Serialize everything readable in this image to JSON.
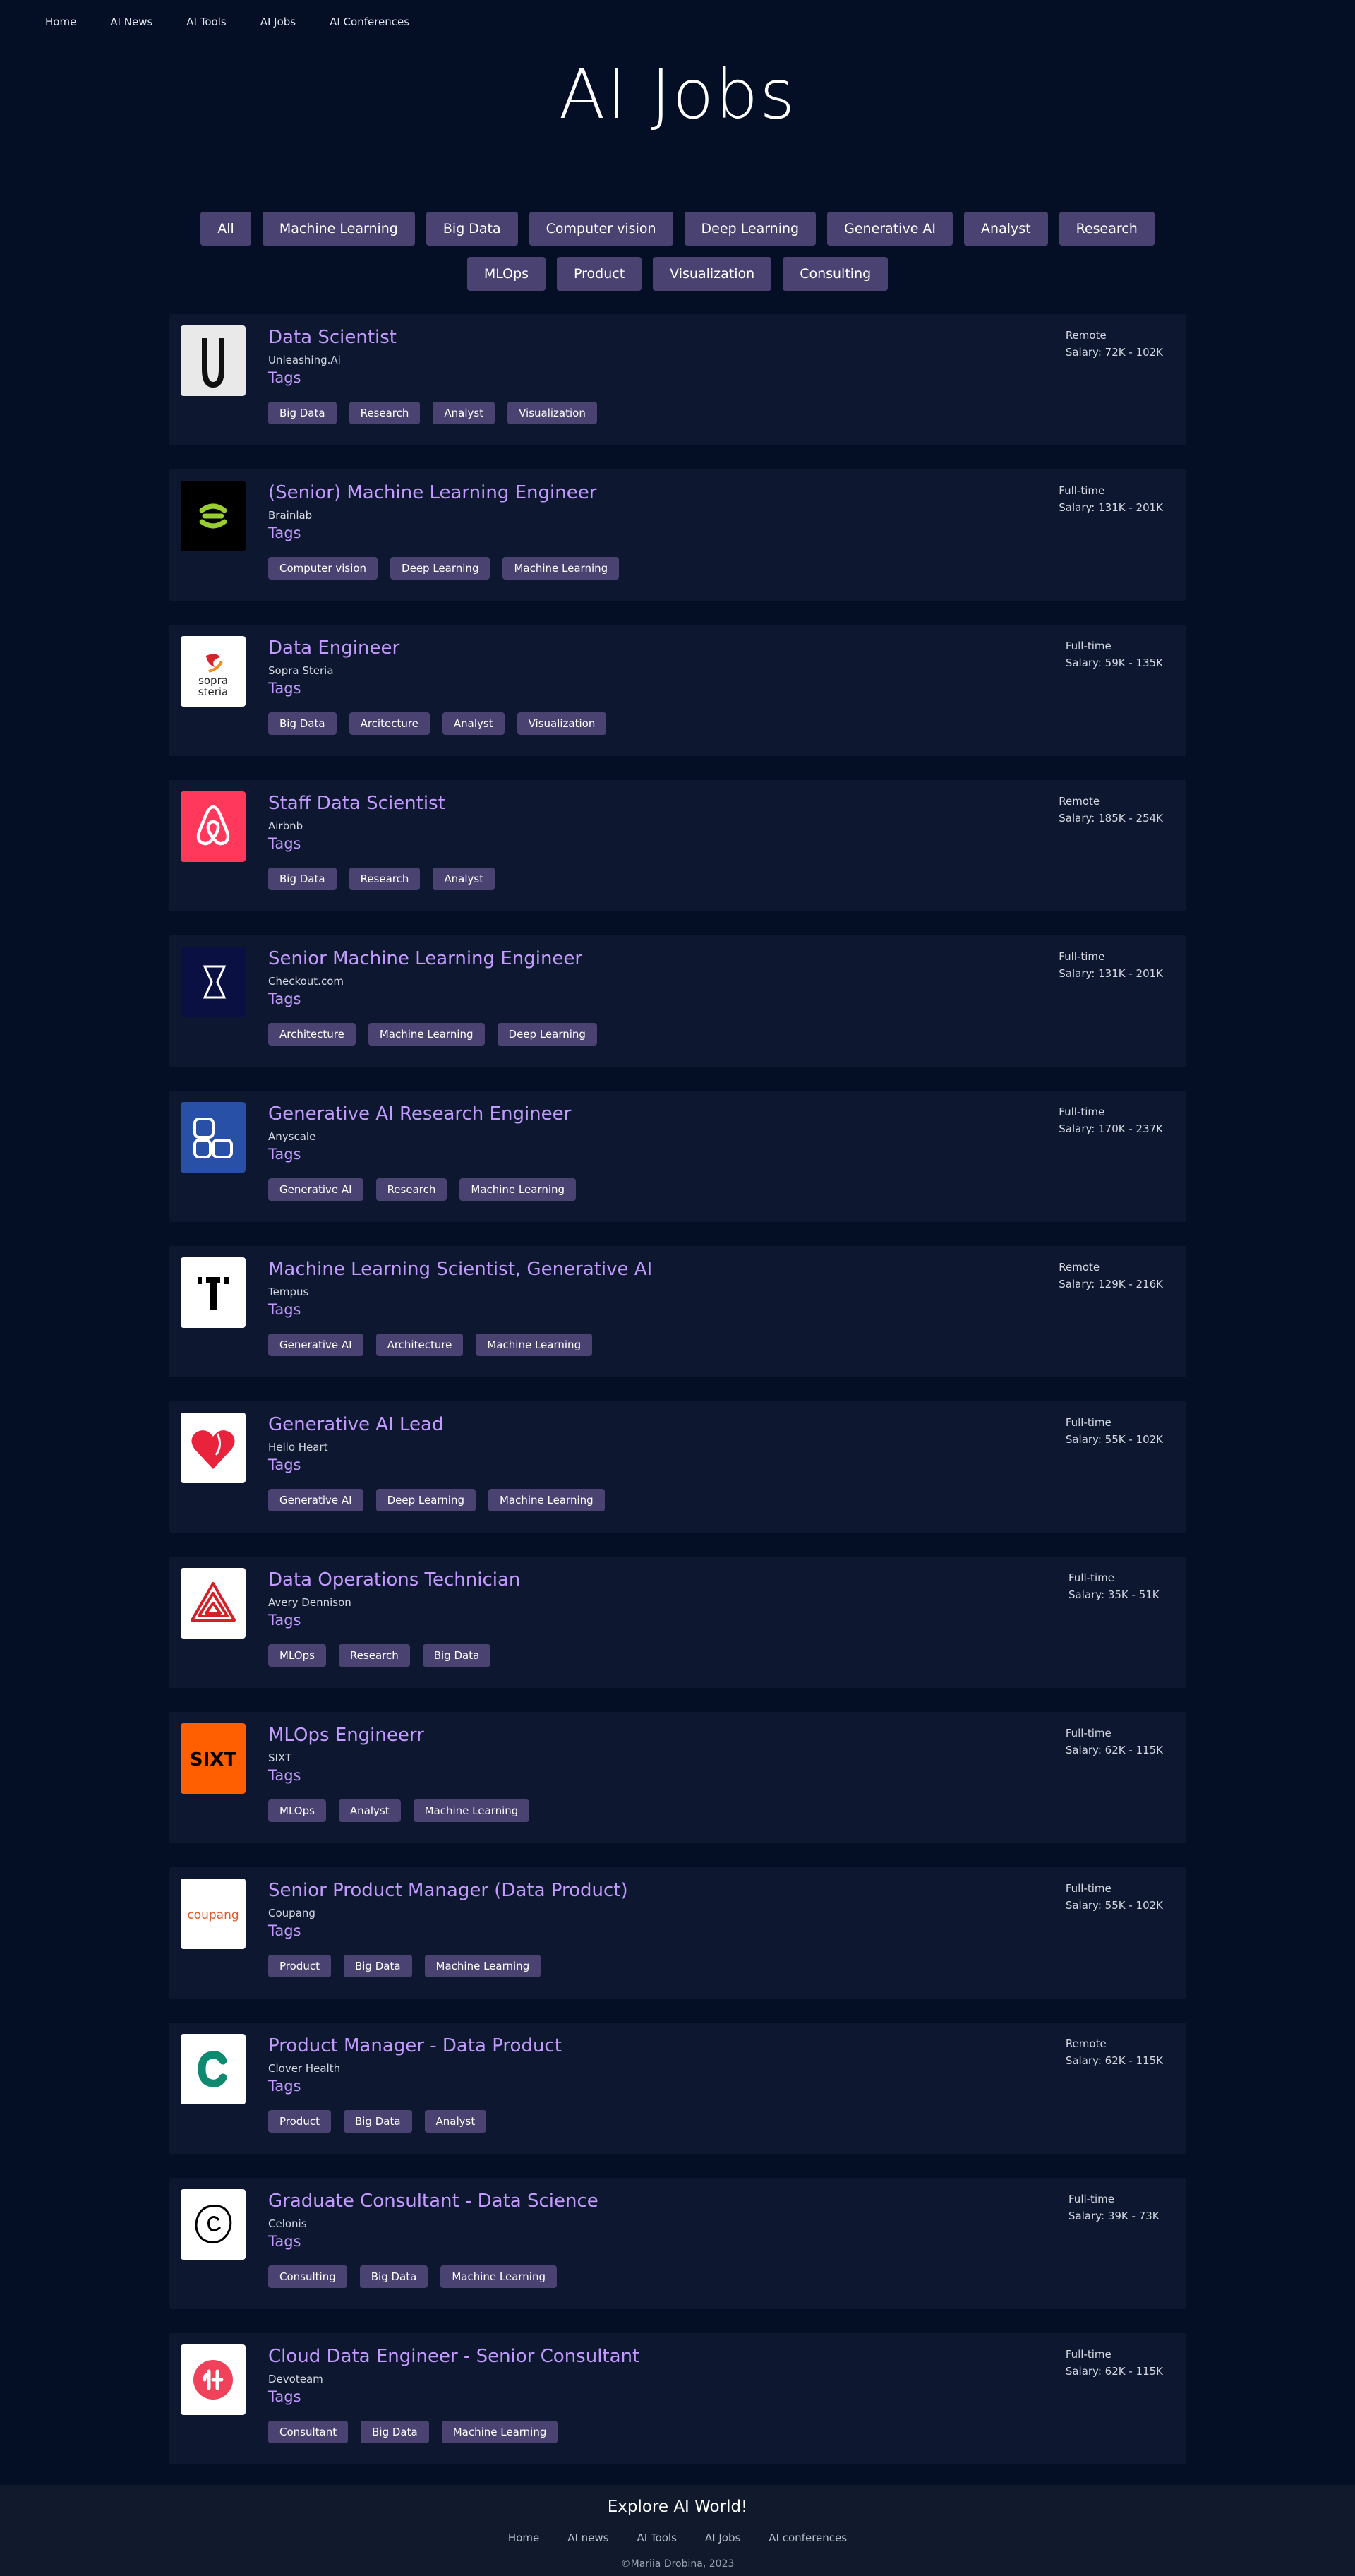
{
  "nav": {
    "items": [
      "Home",
      "AI News",
      "AI Tools",
      "AI Jobs",
      "AI Conferences"
    ]
  },
  "page": {
    "title": "AI Jobs"
  },
  "filters": [
    "All",
    "Machine Learning",
    "Big Data",
    "Computer vision",
    "Deep Learning",
    "Generative AI",
    "Analyst",
    "Research",
    "MLOps",
    "Product",
    "Visualization",
    "Consulting"
  ],
  "tags_label": "Tags",
  "jobs": [
    {
      "title": "Data Scientist",
      "company": "Unleashing.Ai",
      "type": "Remote",
      "salary": "Salary: 72K - 102K",
      "tags": [
        "Big Data",
        "Research",
        "Analyst",
        "Visualization"
      ],
      "logo": "unleashing-logo"
    },
    {
      "title": "(Senior) Machine Learning Engineer",
      "company": "Brainlab",
      "type": "Full-time",
      "salary": "Salary: 131K - 201K",
      "tags": [
        "Computer vision",
        "Deep Learning",
        "Machine Learning"
      ],
      "logo": "brainlab-logo"
    },
    {
      "title": "Data Engineer",
      "company": "Sopra Steria",
      "type": "Full-time",
      "salary": "Salary: 59K - 135K",
      "tags": [
        "Big Data",
        "Arcitecture",
        "Analyst",
        "Visualization"
      ],
      "logo": "sopra-steria-logo"
    },
    {
      "title": "Staff Data Scientist",
      "company": "Airbnb",
      "type": "Remote",
      "salary": "Salary: 185K - 254K",
      "tags": [
        "Big Data",
        "Research",
        "Analyst"
      ],
      "logo": "airbnb-logo"
    },
    {
      "title": "Senior Machine Learning Engineer",
      "company": "Checkout.com",
      "type": "Full-time",
      "salary": "Salary: 131K - 201K",
      "tags": [
        "Architecture",
        "Machine Learning",
        "Deep Learning"
      ],
      "logo": "checkout-logo"
    },
    {
      "title": "Generative AI Research Engineer",
      "company": "Anyscale",
      "type": "Full-time",
      "salary": "Salary: 170K - 237K",
      "tags": [
        "Generative AI",
        "Research",
        "Machine Learning"
      ],
      "logo": "anyscale-logo"
    },
    {
      "title": "Machine Learning Scientist, Generative AI",
      "company": "Tempus",
      "type": "Remote",
      "salary": "Salary: 129K - 216K",
      "tags": [
        "Generative AI",
        "Architecture",
        "Machine Learning"
      ],
      "logo": "tempus-logo"
    },
    {
      "title": "Generative AI Lead",
      "company": "Hello Heart",
      "type": "Full-time",
      "salary": "Salary: 55K - 102K",
      "tags": [
        "Generative AI",
        "Deep Learning",
        "Machine Learning"
      ],
      "logo": "hello-heart-logo"
    },
    {
      "title": "Data Operations Technician",
      "company": "Avery Dennison",
      "type": "Full-time",
      "salary": "Salary: 35K - 51K",
      "tags": [
        "MLOps",
        "Research",
        "Big Data"
      ],
      "logo": "avery-dennison-logo"
    },
    {
      "title": "MLOps Engineerr",
      "company": "SIXT",
      "type": "Full-time",
      "salary": "Salary: 62K - 115K",
      "tags": [
        "MLOps",
        "Analyst",
        "Machine Learning"
      ],
      "logo": "sixt-logo",
      "logo_text": "SIXT"
    },
    {
      "title": "Senior Product Manager (Data Product)",
      "company": "Coupang",
      "type": "Full-time",
      "salary": "Salary: 55K - 102K",
      "tags": [
        "Product",
        "Big Data",
        "Machine Learning"
      ],
      "logo": "coupang-logo",
      "logo_text": "coupang"
    },
    {
      "title": "Product Manager - Data Product",
      "company": "Clover Health",
      "type": "Remote",
      "salary": "Salary: 62K - 115K",
      "tags": [
        "Product",
        "Big Data",
        "Analyst"
      ],
      "logo": "clover-health-logo"
    },
    {
      "title": "Graduate Consultant - Data Science",
      "company": "Celonis",
      "type": "Full-time",
      "salary": "Salary: 39K - 73K",
      "tags": [
        "Consulting",
        "Big Data",
        "Machine Learning"
      ],
      "logo": "celonis-logo"
    },
    {
      "title": "Cloud Data Engineer - Senior Consultant",
      "company": "Devoteam",
      "type": "Full-time",
      "salary": "Salary: 62K - 115K",
      "tags": [
        "Consultant",
        "Big Data",
        "Machine Learning"
      ],
      "logo": "devoteam-logo"
    }
  ],
  "footer": {
    "title": "Explore AI World!",
    "links": [
      "Home",
      "AI news",
      "AI Tools",
      "AI Jobs",
      "AI conferences"
    ],
    "copyright": "©Mariia Drobina, 2023"
  },
  "colors": {
    "background": "#040f26",
    "card": "#0d1830",
    "accent": "#c39bff",
    "chip": "#4a4270"
  }
}
